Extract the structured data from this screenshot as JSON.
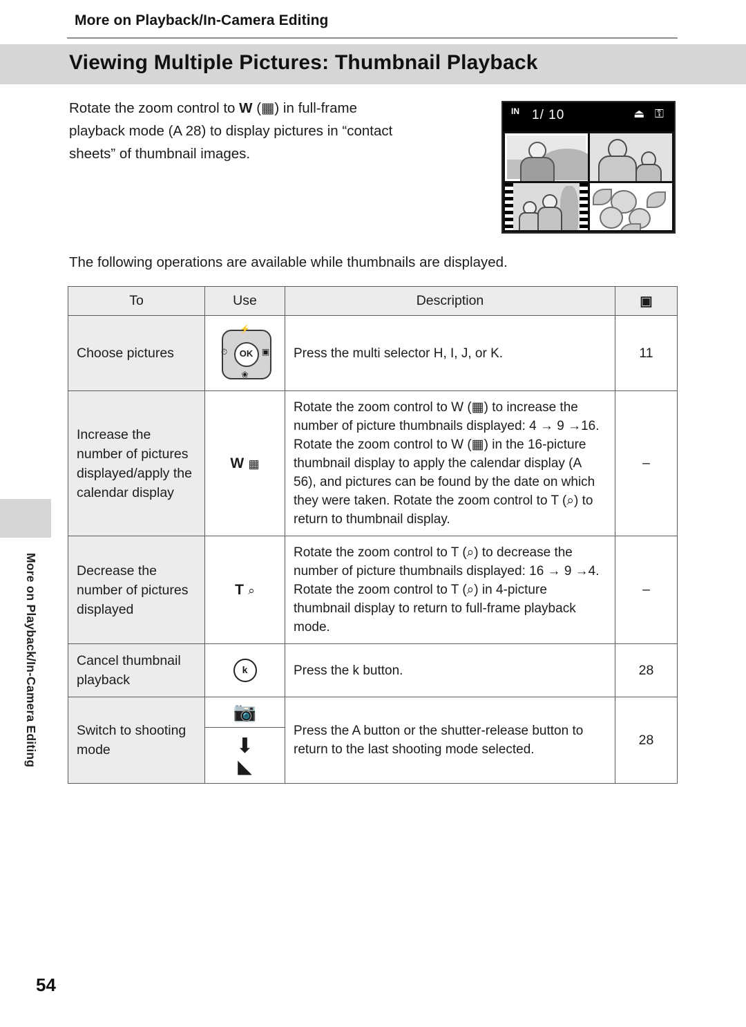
{
  "header": {
    "section": "More on Playback/In-Camera Editing",
    "title": "Viewing Multiple Pictures: Thumbnail Playback"
  },
  "intro": {
    "line1_a": "Rotate the zoom control to ",
    "line1_w": "W",
    "line1_b": " (",
    "line1_icon": "▦",
    "line1_c": ") in full-frame",
    "line2": "playback mode (A 28) to display pictures in “contact",
    "line3": "sheets” of thumbnail images."
  },
  "monitor": {
    "in_badge": "IN",
    "frame_count": "1/ 10",
    "icons": "⏏ ⚿",
    "selected_thumb_index": 1
  },
  "para2": "The following operations are available while thumbnails are displayed.",
  "table": {
    "headers": {
      "to": "To",
      "use": "Use",
      "description": "Description",
      "page": "A"
    },
    "rows": [
      {
        "to": "Choose pictures",
        "use_type": "multiselector",
        "use_label": "OK",
        "description": "Press the multi selector H, I, J, or K.",
        "page": "11"
      },
      {
        "to": "Increase the number of pictures displayed/apply the calendar display",
        "use_type": "zoom-wide",
        "use_label": "W",
        "use_sub": "▦",
        "description": "Rotate the zoom control to W (▦) to increase the number of picture thumbnails displayed: 4 → 9 →16. Rotate the zoom control to W (▦) in the 16-picture thumbnail display to apply the calendar display (A 56), and pictures can be found by the date on which they were taken. Rotate the zoom control to T (⌕) to return to thumbnail display.",
        "page": "–"
      },
      {
        "to": "Decrease the number of pictures displayed",
        "use_type": "zoom-tele",
        "use_label": "T",
        "use_sub": "⌕",
        "description": "Rotate the zoom control to T (⌕) to decrease the number of picture thumbnails displayed: 16 → 9 →4. Rotate the zoom control to T (⌕) in 4-picture thumbnail display to return to full-frame playback mode.",
        "page": "–"
      },
      {
        "to": "Cancel thumbnail playback",
        "use_type": "okbutton",
        "use_label": "k",
        "description": "Press the k button.",
        "page": "28"
      },
      {
        "to": "Switch to shooting mode",
        "use_type": "camera-shutter",
        "use_label": "camera-icon",
        "description": "Press the A button or the shutter-release button to return to the last shooting mode selected.",
        "page": "28"
      }
    ]
  },
  "sidebar": {
    "tab_label": "More on Playback/In-Camera Editing"
  },
  "footer": {
    "page_number": "54"
  }
}
